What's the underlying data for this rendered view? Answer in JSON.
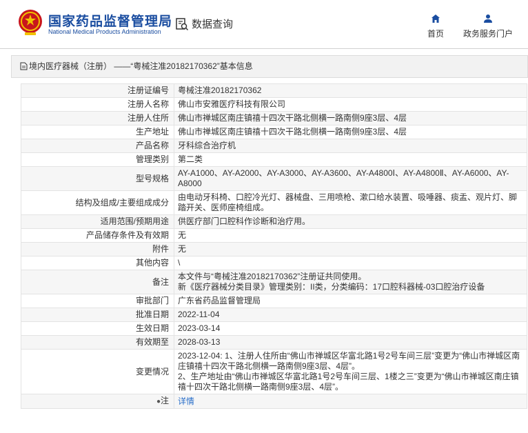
{
  "header": {
    "title_cn": "国家药品监督管理局",
    "title_en": "National Medical Products Administration",
    "query_label": "数据查询",
    "nav_home": "首页",
    "nav_gov": "政务服务门户"
  },
  "breadcrumb": {
    "category": "境内医疗器械（注册）",
    "separator": "——",
    "record": "“粤械注准20182170362”基本信息"
  },
  "rows": [
    {
      "label": "注册证编号",
      "value": "粤械注准20182170362"
    },
    {
      "label": "注册人名称",
      "value": "佛山市安雅医疗科技有限公司"
    },
    {
      "label": "注册人住所",
      "value": "佛山市禅城区南庄镇禧十四次干路北侧横一路南侧9座3层、4层"
    },
    {
      "label": "生产地址",
      "value": "佛山市禅城区南庄镇禧十四次干路北侧横一路南侧9座3层、4层"
    },
    {
      "label": "产品名称",
      "value": "牙科综合治疗机"
    },
    {
      "label": "管理类别",
      "value": "第二类"
    },
    {
      "label": "型号规格",
      "value": "AY-A1000、AY-A2000、AY-A3000、AY-A3600、AY-A4800Ⅰ、AY-A4800Ⅱ、AY-A6000、AY-A8000"
    },
    {
      "label": "结构及组成/主要组成成分",
      "value": "由电动牙科椅、口腔冷光灯、器械盘、三用喷枪、漱口给水装置、吸唾器、痰盂、观片灯、脚踏开关、医师座椅组成。"
    },
    {
      "label": "适用范围/预期用途",
      "value": "供医疗部门口腔科作诊断和治疗用。"
    },
    {
      "label": "产品储存条件及有效期",
      "value": "无"
    },
    {
      "label": "附件",
      "value": "无"
    },
    {
      "label": "其他内容",
      "value": "\\"
    },
    {
      "label": "备注",
      "value": "本文件与“粤械注准20182170362”注册证共同使用。\n新《医疗器械分类目录》管理类别：II类，分类编码：17口腔科器械-03口腔治疗设备"
    },
    {
      "label": "审批部门",
      "value": "广东省药品监督管理局"
    },
    {
      "label": "批准日期",
      "value": "2022-11-04"
    },
    {
      "label": "生效日期",
      "value": "2023-03-14"
    },
    {
      "label": "有效期至",
      "value": "2028-03-13"
    },
    {
      "label": "变更情况",
      "value": "2023-12-04: 1、注册人住所由“佛山市禅城区华富北路1号2号车间三层”变更为“佛山市禅城区南庄镇禧十四次干路北侧横一路南侧9座3层、4层”。\n2、生产地址由“佛山市禅城区华富北路1号2号车间三层、1楼之三”变更为“佛山市禅城区南庄镇禧十四次干路北侧横一路南侧9座3层、4层”。"
    }
  ],
  "note_row": {
    "label": "注",
    "value": "详情"
  },
  "colors": {
    "brand": "#1a4da0",
    "link": "#2a6fc9",
    "emblem_red": "#c8161d",
    "emblem_gold": "#f2c200"
  }
}
